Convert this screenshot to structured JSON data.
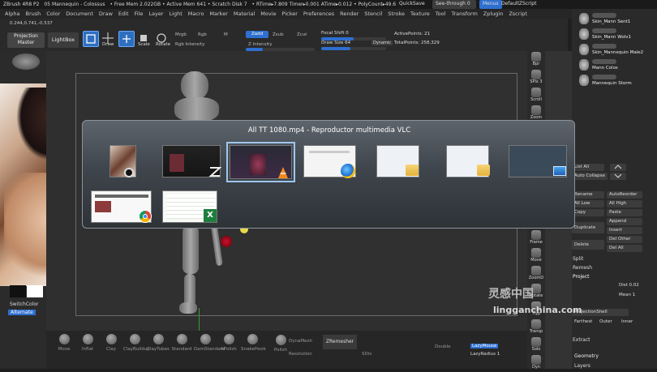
{
  "titlebar": {
    "app": "ZBrush 4R8 P2",
    "doc": "05 Mannequin - Colossus",
    "free_mem": "• Free Mem 2.022GB • Active Mem 641 • Scratch Disk 7",
    "rtime": "• RTime▸7.809 Timer▸0.001 ATime▸0.012 • PolyCount▸49.6",
    "quicksave": "QuickSave",
    "seethrough": "See-through 0",
    "menus_btn": "Menus",
    "script": "DefaultZScript"
  },
  "menu": [
    "Alpha",
    "Brush",
    "Color",
    "Document",
    "Draw",
    "Edit",
    "File",
    "Layer",
    "Light",
    "Macro",
    "Marker",
    "Material",
    "Movie",
    "Picker",
    "Preferences",
    "Render",
    "Stencil",
    "Stroke",
    "Texture",
    "Tool",
    "Transform",
    "Zplugin",
    "Zscript"
  ],
  "toolbar": {
    "coords": "0.244,0.741,-0.537",
    "projection_master": "Projection Master",
    "lightbox": "LightBox",
    "edit": "Edit",
    "draw": "Draw",
    "move": "Move",
    "scale": "Scale",
    "rotate": "Rotate",
    "mrgb": "Mrgb",
    "rgb": "Rgb",
    "m": "M",
    "zadd": "Zadd",
    "zsub": "Zsub",
    "zcut": "Zcut",
    "rgb_intensity": "Rgb Intensity",
    "z_intensity": "Z Intensity",
    "focal_shift": "Focal Shift 0",
    "draw_size": "Draw Size 64",
    "dynamic": "Dynamic",
    "active_points": "ActivePoints: 21",
    "total_points": "TotalPoints: 258,329"
  },
  "left": {
    "switch_color": "SwitchColor",
    "alternate": "Alternate"
  },
  "dock": [
    "Bpr",
    "SPix 3",
    "Scroll",
    "Zoom",
    "Actual",
    "AAHalf",
    "Persp",
    "Floor",
    "Local",
    "L.Sym",
    "Frame",
    "Move",
    "ZoomD",
    "Rotate",
    "Ylyp",
    "Transp",
    "Solo",
    "Dyn"
  ],
  "right": {
    "subtools": [
      "Skin_Mann Sent1",
      "Skin_Mann Wolv1",
      "Skin_Mannequin Male2",
      "Mann Colos",
      "Mannequin Storm"
    ],
    "list_all": "List All",
    "auto_collapse": "Auto Collapse",
    "rename": "Rename",
    "autoreorder": "AutoReorder",
    "all_low": "All Low",
    "all_high": "All High",
    "copy": "Copy",
    "paste": "Paste",
    "append": "Append",
    "duplicate": "Duplicate",
    "insert": "Insert",
    "delete": "Delete",
    "del_other": "Del Other",
    "del_all": "Del All",
    "split": "Split",
    "remesh": "Remesh",
    "project": "Project",
    "dist": "Dist 0.02",
    "mean": "Mean 1",
    "project_shell": "ProjectionShell",
    "farthest": "Farthest",
    "outer": "Outer",
    "inner": "Inner",
    "extract": "Extract",
    "geometry": "Geometry",
    "layers": "Layers"
  },
  "bottom": {
    "brushes": [
      "Move",
      "Inflat",
      "Clay",
      "ClayBuildup",
      "ClayTubes",
      "Standard",
      "DamStandard",
      "hPolish",
      "SnakeHook"
    ],
    "dynamesh": "DynaMesh",
    "resolution": "Resolution",
    "zremesher": "ZRemesher",
    "sdiv": "SDiv",
    "double": "Double",
    "lazymouse": "LazyMouse",
    "lazyradius": "LazyRadius 1",
    "polish": "Polish"
  },
  "switcher": {
    "title": "All TT 1080.mp4 - Reproductor multimedia VLC",
    "thumbs_row1": [
      "mannequin-armor",
      "zbrush-viewer",
      "vlc-player",
      "web-browser",
      "folder-window",
      "folder-window-2",
      "desktop"
    ],
    "thumbs_row2": [
      "chrome-browser",
      "excel-sheet"
    ]
  },
  "watermark": {
    "cn": "灵感中国",
    "url": "lingganchina.com"
  },
  "colors": {
    "accent": "#2e6fd0",
    "panel": "#2a2a2a",
    "switcher_border": "#9ec7ee"
  }
}
